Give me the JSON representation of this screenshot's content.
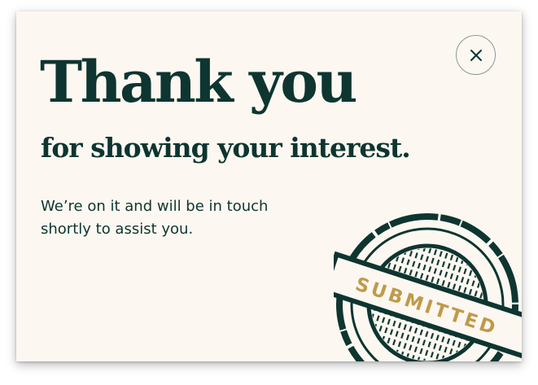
{
  "modal": {
    "title": "Thank you",
    "subtitle": "for showing your interest.",
    "message": "We’re on it and will be in touch shortly to assist you.",
    "close_icon": "close-icon",
    "stamp": {
      "icon": "submitted-stamp-icon",
      "label": "SUBMITTED"
    }
  },
  "colors": {
    "background": "#fcf8f1",
    "text": "#0e3530",
    "stamp": "#0e3530",
    "stamp_label": "#c09a4a"
  }
}
